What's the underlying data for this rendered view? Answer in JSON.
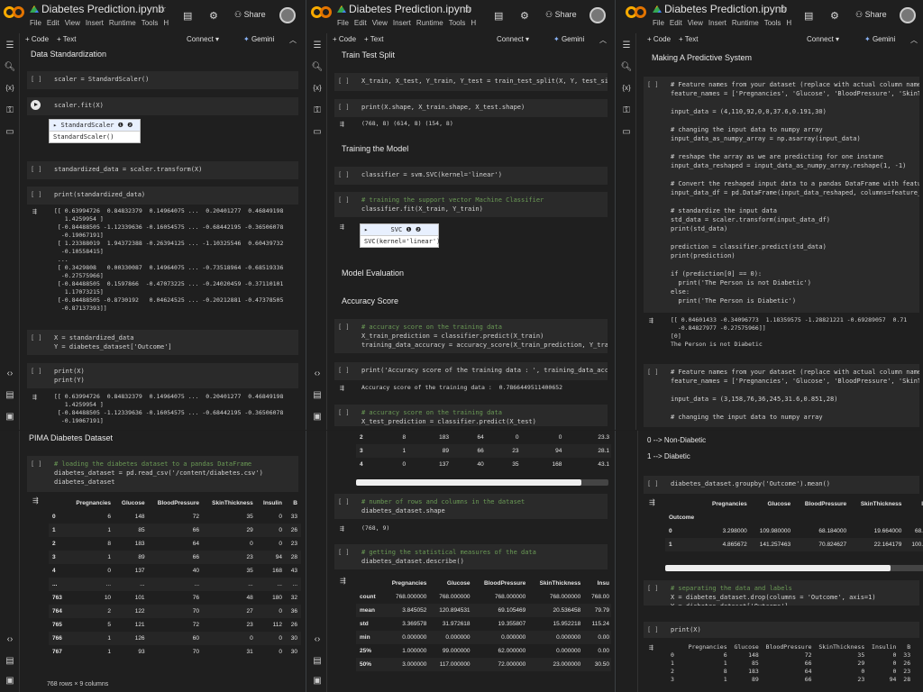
{
  "app": {
    "title": "Diabetes Prediction.ipynb",
    "share": "Share",
    "menu": [
      "File",
      "Edit",
      "View",
      "Insert",
      "Runtime",
      "Tools",
      "H"
    ],
    "toolbar": {
      "code": "+ Code",
      "text": "+ Text",
      "connect": "Connect",
      "gemini": "Gemini"
    }
  },
  "p1": {
    "sec1": "Data Standardization",
    "c1": "scaler = StandardScaler()",
    "c2": "scaler.fit(X)",
    "w1h": "StandardScaler",
    "w1b": "StandardScaler()",
    "c3": "standardized_data = scaler.transform(X)",
    "c4": "print(standardized_data)",
    "o4": "[[ 0.63994726  0.84832379  0.14964075 ...  0.20401277  0.46849198\n   1.4259954 ]\n [-0.84488505 -1.12339636 -0.16054575 ... -0.68442195 -0.36506078\n  -0.19067191]\n [ 1.23388019  1.94372388 -0.26394125 ... -1.10325546  0.60439732\n  -0.10558415]\n ...\n [ 0.3429808   0.00330087  0.14964075 ... -0.73518964 -0.68519336\n  -0.27575966]\n [-0.84488505  0.1597866  -0.47073225 ... -0.24020459 -0.37110101\n   1.17073215]\n [-0.84488505 -0.8730192   0.04624525 ... -0.20212881 -0.47378505\n  -0.87137393]]",
    "c5": "X = standardized_data\nY = diabetes_dataset['Outcome']",
    "c6": "print(X)\nprint(Y)",
    "o6": "[[ 0.63994726  0.84832379  0.14964075 ...  0.20401277  0.46849198\n   1.4259954 ]\n [-0.84488505 -1.12339636 -0.16054575 ... -0.68442195 -0.36506078\n  -0.19067191]"
  },
  "p2": {
    "sec1": "Train Test Split",
    "c1": "X_train, X_test, Y_train, Y_test = train_test_split(X, Y, test_size",
    "c2": "print(X.shape, X_train.shape, X_test.shape)",
    "o2": "(768, 8) (614, 8) (154, 8)",
    "sec2": "Training the Model",
    "c3": "classifier = svm.SVC(kernel='linear')",
    "c4a": "# training the support vector Machine Classifier",
    "c4b": "classifier.fit(X_train, Y_train)",
    "w1h": "SVC",
    "w1b": "SVC(kernel='linear')",
    "sec3": "Model Evaluation",
    "sec4": "Accuracy Score",
    "c5a": "# accuracy score on the training data",
    "c5b": "X_train_prediction = classifier.predict(X_train)\ntraining_data_accuracy = accuracy_score(X_train_prediction, Y_train",
    "c6": "print('Accuracy score of the training data : ', training_data_accura",
    "o6": "Accuracy score of the training data :  0.7866449511400652",
    "c7a": "# accuracy score on the training data",
    "c7b": "X_test_prediction = classifier.predict(X_test)"
  },
  "p3": {
    "sec1": "Making A Predictive System",
    "c1": "# Feature names from your dataset (replace with actual column name\nfeature_names = ['Pregnancies', 'Glucose', 'BloodPressure', 'SkinTh\n\ninput_data = (4,110,92,0,0,37.6,0.191,30)\n\n# changing the input data to numpy array\ninput_data_as_numpy_array = np.asarray(input_data)\n\n# reshape the array as we are predicting for one instane\ninput_data_reshaped = input_data_as_numpy_array.reshape(1, -1)\n\n# Convert the reshaped input data to a pandas DataFrame with featur\ninput_data_df = pd.DataFrame(input_data_reshaped, columns=feature_n\n\n# standardize the input data\nstd_data = scaler.transform(input_data_df)\nprint(std_data)\n\nprediction = classifier.predict(std_data)\nprint(prediction)\n\nif (prediction[0] == 0):\n  print('The Person is not Diabetic')\nelse:\n  print('The Person is Diabetic')",
    "o1": "[[ 0.04601433 -0.34096773  1.18359575 -1.28821221 -0.69289057  0.71\n  -0.84827977 -0.27575966]]\n[0]\nThe Person is not Diabetic",
    "c2": "# Feature names from your dataset (replace with actual column names\nfeature_names = ['Pregnancies', 'Glucose', 'BloodPressure', 'SkinTh\n\ninput_data = (3,158,76,36,245,31.6,0.851,28)\n\n# changing the input data to numpy array"
  },
  "p4": {
    "sec1": "PIMA Diabetes Dataset",
    "c1a": "# loading the diabetes dataset to a pandas DataFrame",
    "c1b": "diabetes_dataset = pd.read_csv('/content/diabetes.csv')\ndiabetes_dataset",
    "cols": [
      "",
      "Pregnancies",
      "Glucose",
      "BloodPressure",
      "SkinThickness",
      "Insulin",
      "B"
    ],
    "rows": [
      [
        "0",
        "6",
        "148",
        "72",
        "35",
        "0",
        "33"
      ],
      [
        "1",
        "1",
        "85",
        "66",
        "29",
        "0",
        "26"
      ],
      [
        "2",
        "8",
        "183",
        "64",
        "0",
        "0",
        "23"
      ],
      [
        "3",
        "1",
        "89",
        "66",
        "23",
        "94",
        "28"
      ],
      [
        "4",
        "0",
        "137",
        "40",
        "35",
        "168",
        "43"
      ],
      [
        "...",
        "...",
        "...",
        "...",
        "...",
        "...",
        "..."
      ],
      [
        "763",
        "10",
        "101",
        "76",
        "48",
        "180",
        "32"
      ],
      [
        "764",
        "2",
        "122",
        "70",
        "27",
        "0",
        "36"
      ],
      [
        "765",
        "5",
        "121",
        "72",
        "23",
        "112",
        "26"
      ],
      [
        "766",
        "1",
        "126",
        "60",
        "0",
        "0",
        "30"
      ],
      [
        "767",
        "1",
        "93",
        "70",
        "31",
        "0",
        "30"
      ]
    ],
    "foot": "768 rows × 9 columns"
  },
  "p5": {
    "rows": [
      [
        "2",
        "8",
        "183",
        "64",
        "0",
        "0",
        "23.3"
      ],
      [
        "3",
        "1",
        "89",
        "66",
        "23",
        "94",
        "28.1"
      ],
      [
        "4",
        "0",
        "137",
        "40",
        "35",
        "168",
        "43.1"
      ]
    ],
    "c1a": "# number of rows and columns in the dataset",
    "c1b": "diabetes_dataset.shape",
    "o1": "(768, 9)",
    "c2a": "# getting the statistical measures of the data",
    "c2b": "diabetes_dataset.describe()",
    "cols": [
      "",
      "Pregnancies",
      "Glucose",
      "BloodPressure",
      "SkinThickness",
      "Insu"
    ],
    "drows": [
      [
        "count",
        "768.000000",
        "768.000000",
        "768.000000",
        "768.000000",
        "768.00"
      ],
      [
        "mean",
        "3.845052",
        "120.894531",
        "69.105469",
        "20.536458",
        "79.79"
      ],
      [
        "std",
        "3.369578",
        "31.972618",
        "19.355807",
        "15.952218",
        "115.24"
      ],
      [
        "min",
        "0.000000",
        "0.000000",
        "0.000000",
        "0.000000",
        "0.00"
      ],
      [
        "25%",
        "1.000000",
        "99.000000",
        "62.000000",
        "0.000000",
        "0.00"
      ],
      [
        "50%",
        "3.000000",
        "117.000000",
        "72.000000",
        "23.000000",
        "30.50"
      ]
    ]
  },
  "p6": {
    "t1": "0 --> Non-Diabetic",
    "t2": "1 --> Diabetic",
    "c1": "diabetes_dataset.groupby('Outcome').mean()",
    "gcols": [
      "",
      "Pregnancies",
      "Glucose",
      "BloodPressure",
      "SkinThickness",
      "I"
    ],
    "gidx": "Outcome",
    "grows": [
      [
        "0",
        "3.298000",
        "109.980000",
        "68.184000",
        "19.664000",
        "68."
      ],
      [
        "1",
        "4.865672",
        "141.257463",
        "70.824627",
        "22.164179",
        "100."
      ]
    ],
    "c2a": "# separating the data and labels",
    "c2b": "X = diabetes_dataset.drop(columns = 'Outcome', axis=1)\nY = diabetes_dataset['Outcome']",
    "c3": "print(X)",
    "o3": "     Pregnancies  Glucose  BloodPressure  SkinThickness  Insulin   B\n0              6      148             72             35        0  33\n1              1       85             66             29        0  26\n2              8      183             64              0        0  23\n3              1       89             66             23       94  28"
  }
}
